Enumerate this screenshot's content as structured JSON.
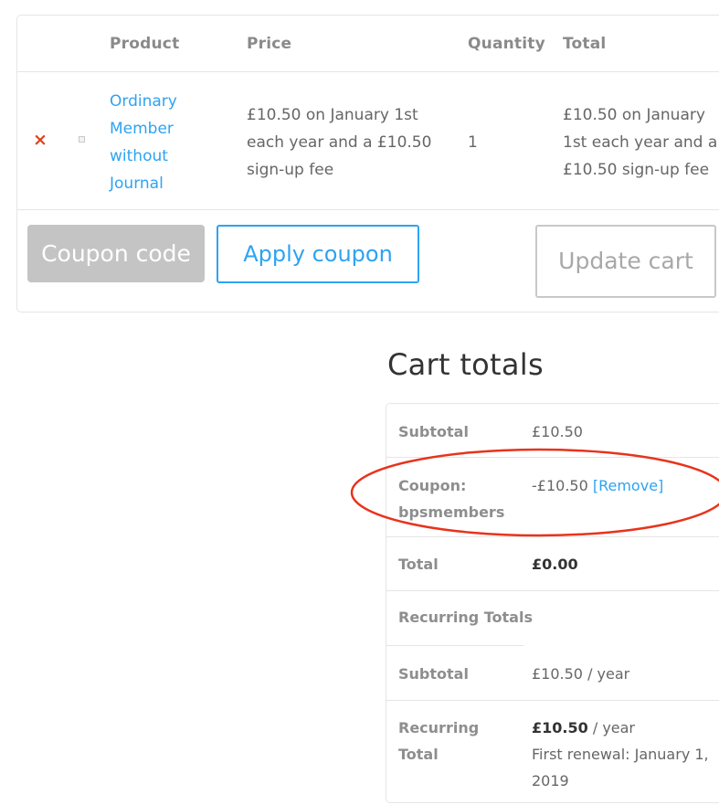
{
  "cart_table": {
    "headers": {
      "product": "Product",
      "price": "Price",
      "quantity": "Quantity",
      "total": "Total"
    },
    "rows": [
      {
        "remove_glyph": "×",
        "remove_icon": "close-icon",
        "product_name": "Ordinary Member without Journal",
        "price": "£10.50 on January 1st each year and a £10.50 sign-up fee",
        "quantity": "1",
        "total": "£10.50 on January 1st each year and a £10.50 sign-up fee"
      }
    ],
    "coupon_placeholder": "Coupon code",
    "apply_coupon_label": "Apply coupon",
    "update_cart_label": "Update cart"
  },
  "cart_totals": {
    "title": "Cart totals",
    "subtotal_label": "Subtotal",
    "subtotal_value": "£10.50",
    "coupon_label": "Coupon: bpsmembers",
    "coupon_value": "-£10.50",
    "coupon_remove": "[Remove]",
    "total_label": "Total",
    "total_value": "£0.00",
    "recurring_heading": "Recurring Totals",
    "recurring_subtotal_label": "Subtotal",
    "recurring_subtotal_value": "£10.50 / year",
    "recurring_total_label": "Recurring Total",
    "recurring_total_amount": "£10.50",
    "recurring_total_period": " / year",
    "first_renewal": "First renewal: January 1, 2019"
  },
  "colors": {
    "accent_blue": "#2ea3f2",
    "remove_red": "#e2401c",
    "annotation_red": "#e8331c",
    "border_grey": "#e5e5e5"
  }
}
